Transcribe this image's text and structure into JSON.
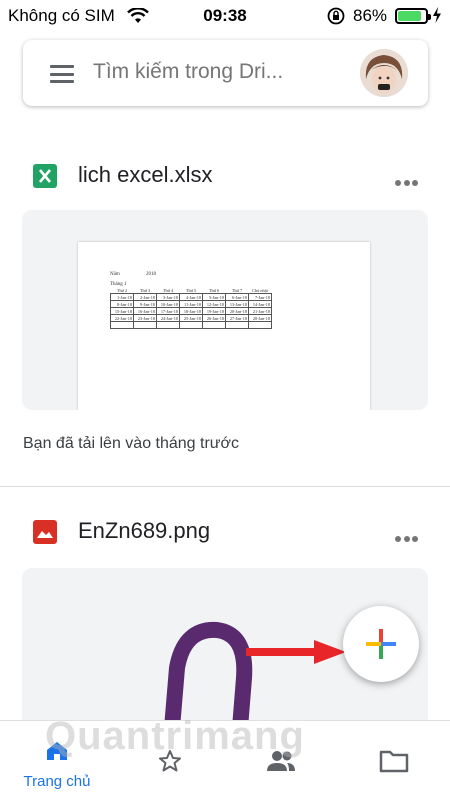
{
  "status_bar": {
    "carrier": "Không có SIM",
    "time": "09:38",
    "battery_percent": "86%",
    "battery_level": 0.86,
    "battery_color": "#4cd964"
  },
  "search": {
    "placeholder": "Tìm kiếm trong Dri..."
  },
  "files": [
    {
      "name": "lich excel.xlsx",
      "type_icon": "excel-icon",
      "icon_color": "#21a366",
      "caption": "Bạn đã tải lên vào tháng trước",
      "preview": {
        "label_a": "Năm",
        "label_b": "2018",
        "month": "Tháng 1",
        "headers": [
          "Thứ 2",
          "Thứ 3",
          "Thứ 4",
          "Thứ 5",
          "Thứ 6",
          "Thứ 7",
          "Chủ nhật"
        ],
        "rows": [
          [
            "1-Jan-18",
            "2-Jan-18",
            "3-Jan-18",
            "4-Jan-18",
            "5-Jan-18",
            "6-Jan-18",
            "7-Jan-18"
          ],
          [
            "8-Jan-18",
            "9-Jan-18",
            "10-Jan-18",
            "11-Jan-18",
            "12-Jan-18",
            "13-Jan-18",
            "14-Jan-18"
          ],
          [
            "15-Jan-18",
            "16-Jan-18",
            "17-Jan-18",
            "18-Jan-18",
            "19-Jan-18",
            "20-Jan-18",
            "21-Jan-18"
          ],
          [
            "22-Jan-18",
            "23-Jan-18",
            "24-Jan-18",
            "25-Jan-18",
            "26-Jan-18",
            "27-Jan-18",
            "28-Jan-18"
          ],
          [
            "",
            "",
            "",
            "",
            "",
            "",
            ""
          ]
        ]
      }
    },
    {
      "name": "EnZn689.png",
      "type_icon": "image-icon",
      "icon_color": "#d93025"
    }
  ],
  "bottom_nav": {
    "home_label": "Trang chủ",
    "active_color": "#1a73e8"
  },
  "watermark": "Quantrimang"
}
